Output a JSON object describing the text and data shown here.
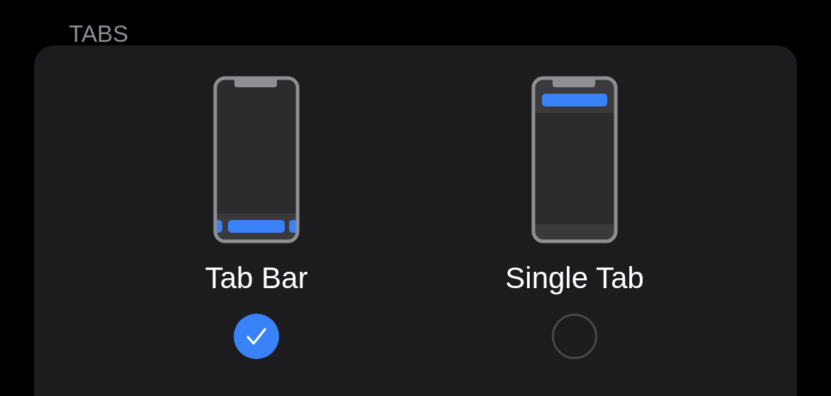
{
  "section": {
    "title": "TABS"
  },
  "options": [
    {
      "label": "Tab Bar",
      "kind": "tab-bar",
      "selected": true
    },
    {
      "label": "Single Tab",
      "kind": "single-tab",
      "selected": false
    }
  ]
}
